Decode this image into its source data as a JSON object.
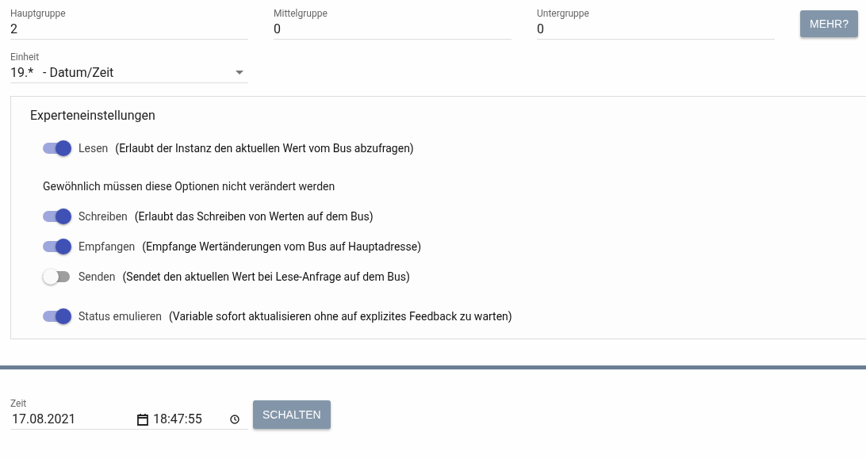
{
  "address_fields": [
    {
      "label": "Hauptgruppe",
      "value": "2"
    },
    {
      "label": "Mittelgruppe",
      "value": "0"
    },
    {
      "label": "Untergruppe",
      "value": "0"
    }
  ],
  "more_button": "MEHR?",
  "unit_select": {
    "label": "Einheit",
    "value": "19.*   - Datum/Zeit"
  },
  "expert_panel": {
    "title": "Experteneinstellungen",
    "groups": [
      {
        "toggles": [
          {
            "label": "Lesen",
            "description": "(Erlaubt der Instanz den aktuellen Wert vom Bus abzufragen)",
            "on": true
          }
        ]
      },
      {
        "note": "Gewöhnlich müssen diese Optionen nicht verändert werden",
        "toggles": [
          {
            "label": "Schreiben",
            "description": "(Erlaubt das Schreiben von Werten auf dem Bus)",
            "on": true
          },
          {
            "label": "Empfangen",
            "description": "(Empfange Wertänderungen vom Bus auf Hauptadresse)",
            "on": true
          },
          {
            "label": "Senden",
            "description": "(Sendet den aktuellen Wert bei Lese-Anfrage auf dem Bus)",
            "on": false
          }
        ]
      },
      {
        "toggles": [
          {
            "label": "Status emulieren",
            "description": "(Variable sofort aktualisieren ohne auf explizites Feedback zu warten)",
            "on": true
          }
        ]
      }
    ]
  },
  "time_field": {
    "label": "Zeit",
    "date": "17.08.2021",
    "time": "18:47:55"
  },
  "switch_button": "SCHALTEN"
}
